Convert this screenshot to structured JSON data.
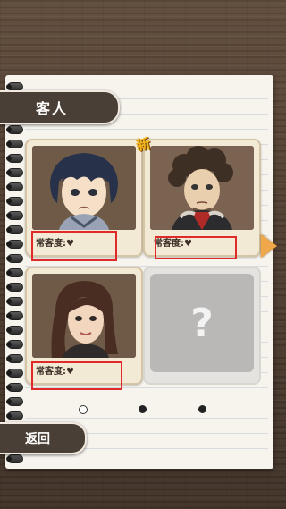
{
  "header": {
    "title": "客人"
  },
  "badge": {
    "new_label": "新"
  },
  "customers": [
    {
      "name": "boy-customer",
      "affinity_label": "常客度:",
      "affinity_icon": "heart-icon"
    },
    {
      "name": "afro-customer",
      "affinity_label": "常客度:",
      "affinity_icon": "heart-icon"
    },
    {
      "name": "woman-customer",
      "affinity_label": "常客度:",
      "affinity_icon": "heart-icon"
    }
  ],
  "locked_slot": {
    "symbol": "?"
  },
  "pagination": {
    "pages": 3,
    "current": 1
  },
  "footer": {
    "back_label": "返回"
  },
  "colors": {
    "highlight": "#e02a2a",
    "tab_bg": "#4a3f36",
    "arrow": "#f0a74a",
    "new_badge": "#f2b21b"
  }
}
